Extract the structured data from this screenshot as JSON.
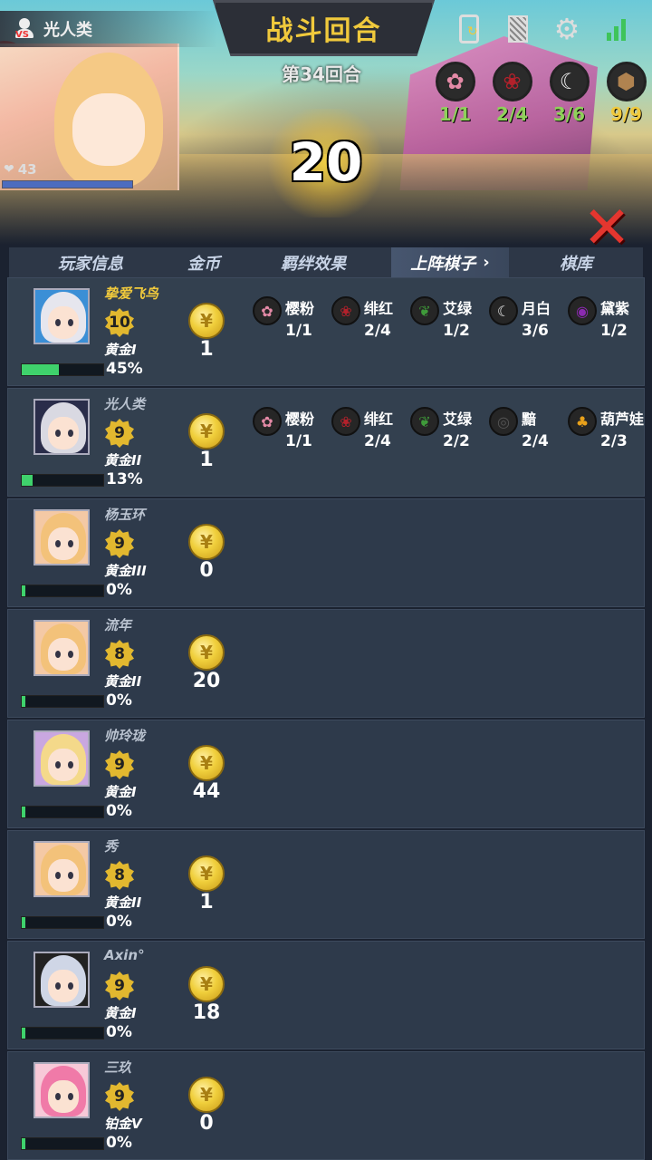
{
  "header": {
    "player_name": "光人类",
    "title": "战斗回合",
    "round": "第34回合",
    "countdown": "20",
    "hp": "43",
    "top_bonds": [
      {
        "name": "cherry-blossom-icon",
        "value": "1/1",
        "color": "#e58aa7",
        "value_color": "#8fd15a"
      },
      {
        "name": "rose-icon",
        "value": "2/4",
        "color": "#b3212b",
        "value_color": "#8fd15a"
      },
      {
        "name": "moon-eye-icon",
        "value": "3/6",
        "color": "#eeeeee",
        "value_color": "#8fd15a"
      },
      {
        "name": "hexagon-emblem-icon",
        "value": "9/9",
        "color": "#b08350",
        "value_color": "#f0c93c"
      }
    ]
  },
  "table": {
    "headers": {
      "player_info": "玩家信息",
      "coins": "金币",
      "bonds": "羁绊效果",
      "deployed": "上阵棋子",
      "bench": "棋库"
    },
    "rows": [
      {
        "name": "挚爱飞鸟",
        "level": "10",
        "rank": "黄金I",
        "progress": 45,
        "percent": "45%",
        "coins": "1",
        "avatar_bg": "#3b8fd6",
        "avatar_hair": "#e6e6ee",
        "is_me": true,
        "bonds": [
          {
            "icon": "cherry-blossom-icon",
            "glyph": "✿",
            "color": "#e58aa7",
            "name": "樱粉",
            "value": "1/1"
          },
          {
            "icon": "rose-icon",
            "glyph": "❀",
            "color": "#b3212b",
            "name": "绯红",
            "value": "2/4"
          },
          {
            "icon": "leaf-icon",
            "glyph": "❦",
            "color": "#3f9b3a",
            "name": "艾绿",
            "value": "1/2"
          },
          {
            "icon": "moon-eye-icon",
            "glyph": "☾",
            "color": "#eeeeee",
            "name": "月白",
            "value": "3/6"
          },
          {
            "icon": "swirl-icon",
            "glyph": "◉",
            "color": "#8b2ab0",
            "name": "黛紫",
            "value": "1/2"
          }
        ]
      },
      {
        "name": "光人类",
        "level": "9",
        "rank": "黄金II",
        "progress": 13,
        "percent": "13%",
        "coins": "1",
        "avatar_bg": "#2a2d4a",
        "avatar_hair": "#d9d9e2",
        "is_me": false,
        "bonds": [
          {
            "icon": "cherry-blossom-icon",
            "glyph": "✿",
            "color": "#e58aa7",
            "name": "樱粉",
            "value": "1/1"
          },
          {
            "icon": "rose-icon",
            "glyph": "❀",
            "color": "#b3212b",
            "name": "绯红",
            "value": "2/4"
          },
          {
            "icon": "leaf-icon",
            "glyph": "❦",
            "color": "#3f9b3a",
            "name": "艾绿",
            "value": "2/2"
          },
          {
            "icon": "eye-icon",
            "glyph": "◎",
            "color": "#555555",
            "name": "黯",
            "value": "2/4"
          },
          {
            "icon": "gourd-icon",
            "glyph": "♣",
            "color": "#e9a11a",
            "name": "葫芦娃",
            "value": "2/3"
          }
        ]
      },
      {
        "name": "杨玉环",
        "level": "9",
        "rank": "黄金III",
        "progress": 0,
        "percent": "0%",
        "coins": "0",
        "avatar_bg": "#f4c9a5",
        "avatar_hair": "#f3c27a",
        "is_me": false,
        "bonds": []
      },
      {
        "name": "流年",
        "level": "8",
        "rank": "黄金II",
        "progress": 0,
        "percent": "0%",
        "coins": "20",
        "avatar_bg": "#f4c9a5",
        "avatar_hair": "#f3c27a",
        "is_me": false,
        "bonds": []
      },
      {
        "name": "帅玲珑",
        "level": "9",
        "rank": "黄金I",
        "progress": 0,
        "percent": "0%",
        "coins": "44",
        "avatar_bg": "#c9a7e0",
        "avatar_hair": "#f4d98a",
        "is_me": false,
        "bonds": []
      },
      {
        "name": "秀",
        "level": "8",
        "rank": "黄金II",
        "progress": 0,
        "percent": "0%",
        "coins": "1",
        "avatar_bg": "#f4c9a5",
        "avatar_hair": "#f3c27a",
        "is_me": false,
        "bonds": []
      },
      {
        "name": "Axin°",
        "level": "9",
        "rank": "黄金I",
        "progress": 0,
        "percent": "0%",
        "coins": "18",
        "avatar_bg": "#222222",
        "avatar_hair": "#cfd6e6",
        "is_me": false,
        "bonds": []
      },
      {
        "name": "三玖",
        "level": "9",
        "rank": "铂金V",
        "progress": 0,
        "percent": "0%",
        "coins": "0",
        "avatar_bg": "#f7c9d8",
        "avatar_hair": "#f07aa8",
        "is_me": false,
        "bonds": []
      }
    ]
  }
}
